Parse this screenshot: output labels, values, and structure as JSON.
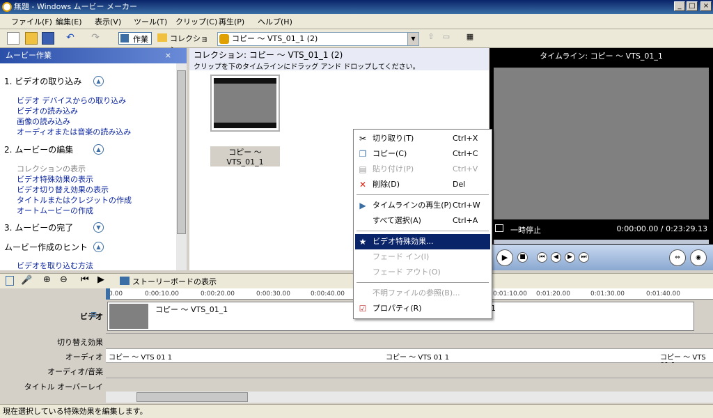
{
  "window": {
    "title": "無題 - Windows ムービー メーカー",
    "min": "_",
    "max": "□",
    "close": "×"
  },
  "menu": [
    "ファイル(F)",
    "編集(E)",
    "表示(V)",
    "ツール(T)",
    "クリップ(C)",
    "再生(P)",
    "ヘルプ(H)"
  ],
  "toolbar": {
    "tasks_label": "作業",
    "collections_label": "コレクション",
    "collection_value": "コピー 〜 VTS_01_1 (2)"
  },
  "taskpane": {
    "title": "ムービー作業",
    "close": "×",
    "sections": [
      {
        "title": "1. ビデオの取り込み",
        "links": [
          "ビデオ デバイスからの取り込み",
          "ビデオの読み込み",
          "画像の読み込み",
          "オーディオまたは音楽の読み込み"
        ]
      },
      {
        "title": "2. ムービーの編集",
        "disabled": "コレクションの表示",
        "links": [
          "ビデオ特殊効果の表示",
          "ビデオ切り替え効果の表示",
          "タイトルまたはクレジットの作成",
          "オートムービーの作成"
        ]
      },
      {
        "title": "3. ムービーの完了"
      },
      {
        "title": "ムービー作成のヒント",
        "links": [
          "ビデオを取り込む方法"
        ]
      }
    ]
  },
  "collection": {
    "title": "コレクション: コピー 〜 VTS_01_1 (2)",
    "hint": "クリップを下のタイムラインにドラッグ アンド ドロップしてください。",
    "clip_label": "コピー 〜 VTS_01_1"
  },
  "monitor": {
    "title": "タイムライン: コピー 〜 VTS_01_1",
    "status": "一時停止",
    "time": "0:00:00.00 / 0:23:29.13"
  },
  "context_menu": [
    {
      "label": "切り取り(T)",
      "shortcut": "Ctrl+X",
      "icon": "scissors-icon",
      "enabled": true
    },
    {
      "label": "コピー(C)",
      "shortcut": "Ctrl+C",
      "icon": "copy-icon",
      "enabled": true
    },
    {
      "label": "貼り付け(P)",
      "shortcut": "Ctrl+V",
      "icon": "paste-icon",
      "enabled": false
    },
    {
      "label": "削除(D)",
      "shortcut": "Del",
      "icon": "delete-x-icon",
      "enabled": true
    },
    {
      "label": "タイムラインの再生(P)",
      "shortcut": "Ctrl+W",
      "icon": "play-icon",
      "enabled": true
    },
    {
      "label": "すべて選択(A)",
      "shortcut": "Ctrl+A",
      "icon": "",
      "enabled": true
    },
    {
      "label": "ビデオ特殊効果...",
      "shortcut": "",
      "icon": "star-effect-icon",
      "enabled": true,
      "selected": true
    },
    {
      "label": "フェード イン(I)",
      "shortcut": "",
      "icon": "",
      "enabled": false
    },
    {
      "label": "フェード アウト(O)",
      "shortcut": "",
      "icon": "",
      "enabled": false
    },
    {
      "label": "不明ファイルの参照(B)...",
      "shortcut": "",
      "icon": "",
      "enabled": false
    },
    {
      "label": "プロパティ(R)",
      "shortcut": "",
      "icon": "properties-icon",
      "enabled": true
    }
  ],
  "timeline": {
    "storyboard_label": "ストーリーボードの表示",
    "ruler": [
      "0.00",
      "0:00:10.00",
      "0:00:20.00",
      "0:00:30.00",
      "0:00:40.00",
      "0:01:10.00",
      "0:01:20.00",
      "0:01:30.00",
      "0:01:40.00"
    ],
    "tracks": {
      "video": "ビデオ",
      "transition": "切り替え効果",
      "audio": "オーディオ",
      "audio_music": "オーディオ/音楽",
      "title_overlay": "タイトル オーバーレイ"
    },
    "video_clip": "コピー 〜 VTS_01_1",
    "video_clip_partial": "1",
    "audio_clip": "コピー 〜 VTS 01 1",
    "collapse": "⊟"
  },
  "status": "現在選択している特殊効果を編集します。"
}
